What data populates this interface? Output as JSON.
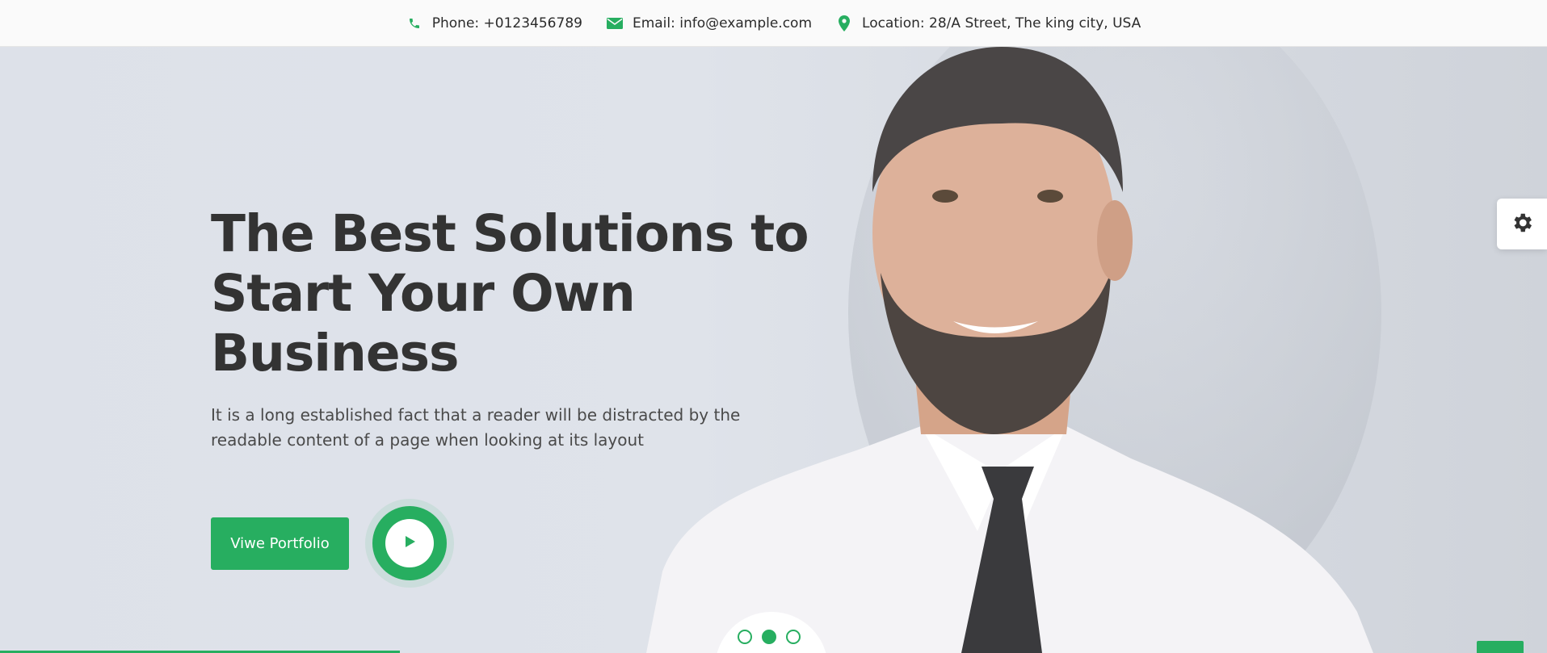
{
  "topbar": {
    "phone": "Phone: +0123456789",
    "email": "Email: info@example.com",
    "location": "Location: 28/A Street, The king city, USA",
    "icons": [
      "phone-icon",
      "envelope-icon",
      "map-pin-icon"
    ]
  },
  "hero": {
    "title": "The Best Solutions to\nStart Your Own Business",
    "description": "It is a long established fact that a reader will be distracted by the readable content of a page when looking at its layout",
    "primary_button": "Viwe Portfolio",
    "play_icon": "play-icon"
  },
  "slider": {
    "dots": 3,
    "active": 1
  },
  "settings_icon": "gear-icon",
  "colors": {
    "accent": "#27ae60",
    "title": "#333333",
    "topbar_bg": "#fafafa",
    "hero_bg": "#dfe3ea"
  }
}
